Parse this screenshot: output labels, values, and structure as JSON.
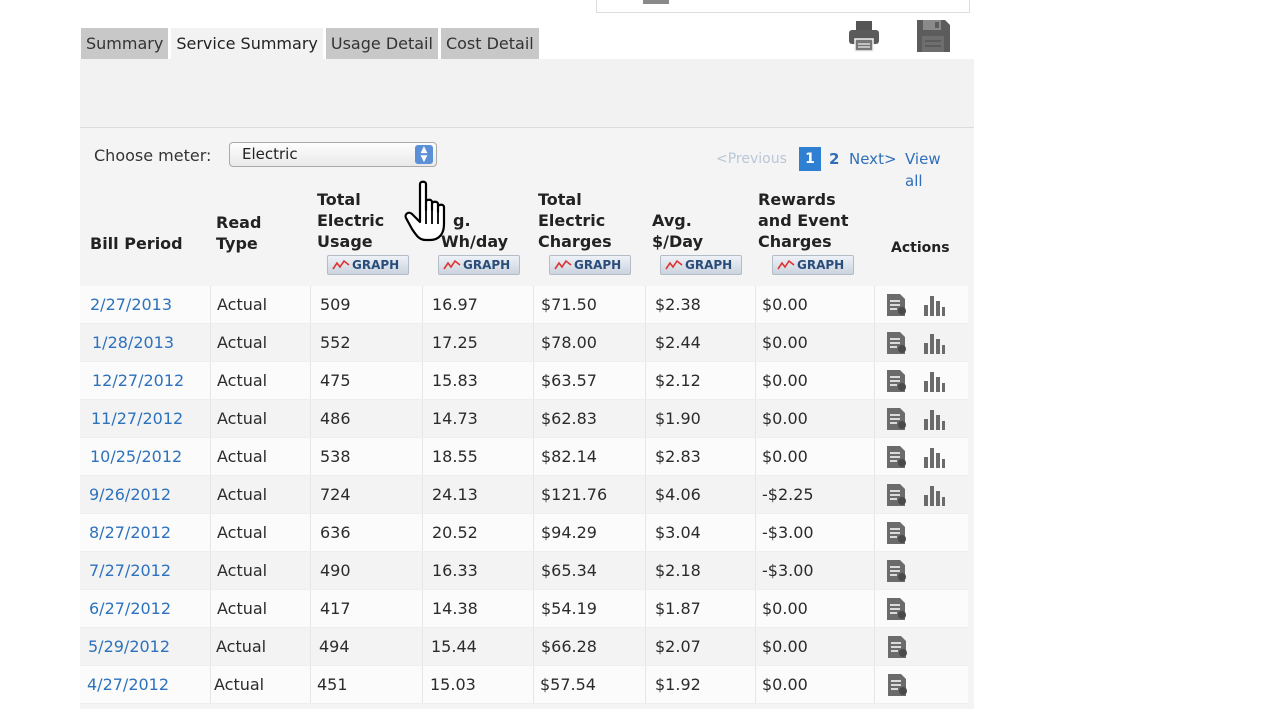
{
  "tabs": [
    {
      "label": "Summary",
      "active": false
    },
    {
      "label": "Service Summary",
      "active": true
    },
    {
      "label": "Usage Detail",
      "active": false
    },
    {
      "label": "Cost Detail",
      "active": false
    }
  ],
  "toolbar": {
    "print_icon": "printer-icon",
    "save_icon": "floppy-disk-icon"
  },
  "meter": {
    "label": "Choose meter:",
    "selected": "Electric"
  },
  "pagination": {
    "previous": "<Previous",
    "current": "1",
    "page2": "2",
    "next": "Next>",
    "view_all": "View all"
  },
  "columns": {
    "bill_period": "Bill Period",
    "read_type_1": "Read",
    "read_type_2": "Type",
    "usage_1": "Total",
    "usage_2": "Electric",
    "usage_3": "Usage",
    "avg_kwh_1": "g.",
    "avg_kwh_2": "Wh/day",
    "charges_1": "Total",
    "charges_2": "Electric",
    "charges_3": "Charges",
    "avg_day_1": "Avg.",
    "avg_day_2": "$/Day",
    "rewards_1": "Rewards",
    "rewards_2": "and Event",
    "rewards_3": "Charges",
    "actions": "Actions",
    "graph_label": "GRAPH"
  },
  "rows": [
    {
      "period": "2/27/2013",
      "type": "Actual",
      "usage": "509",
      "kwh_day": "16.97",
      "charges": "$71.50",
      "per_day": "$2.38",
      "rewards": "$0.00",
      "graph": true
    },
    {
      "period": "1/28/2013",
      "type": "Actual",
      "usage": "552",
      "kwh_day": "17.25",
      "charges": "$78.00",
      "per_day": "$2.44",
      "rewards": "$0.00",
      "graph": true
    },
    {
      "period": "12/27/2012",
      "type": "Actual",
      "usage": "475",
      "kwh_day": "15.83",
      "charges": "$63.57",
      "per_day": "$2.12",
      "rewards": "$0.00",
      "graph": true
    },
    {
      "period": "11/27/2012",
      "type": "Actual",
      "usage": "486",
      "kwh_day": "14.73",
      "charges": "$62.83",
      "per_day": "$1.90",
      "rewards": "$0.00",
      "graph": true
    },
    {
      "period": "10/25/2012",
      "type": "Actual",
      "usage": "538",
      "kwh_day": "18.55",
      "charges": "$82.14",
      "per_day": "$2.83",
      "rewards": "$0.00",
      "graph": true
    },
    {
      "period": "9/26/2012",
      "type": "Actual",
      "usage": "724",
      "kwh_day": "24.13",
      "charges": "$121.76",
      "per_day": "$4.06",
      "rewards": "-$2.25",
      "graph": true
    },
    {
      "period": "8/27/2012",
      "type": "Actual",
      "usage": "636",
      "kwh_day": "20.52",
      "charges": "$94.29",
      "per_day": "$3.04",
      "rewards": "-$3.00",
      "graph": false
    },
    {
      "period": "7/27/2012",
      "type": "Actual",
      "usage": "490",
      "kwh_day": "16.33",
      "charges": "$65.34",
      "per_day": "$2.18",
      "rewards": "-$3.00",
      "graph": false
    },
    {
      "period": "6/27/2012",
      "type": "Actual",
      "usage": "417",
      "kwh_day": "14.38",
      "charges": "$54.19",
      "per_day": "$1.87",
      "rewards": "$0.00",
      "graph": false
    },
    {
      "period": "5/29/2012",
      "type": "Actual",
      "usage": "494",
      "kwh_day": "15.44",
      "charges": "$66.28",
      "per_day": "$2.07",
      "rewards": "$0.00",
      "graph": false
    },
    {
      "period": "4/27/2012",
      "type": "Actual",
      "usage": "451",
      "kwh_day": "15.03",
      "charges": "$57.54",
      "per_day": "$1.92",
      "rewards": "$0.00",
      "graph": false
    }
  ],
  "colors": {
    "link": "#2d72bd",
    "pager_active": "#2f7fd2",
    "tab_inactive": "#c8c8c8"
  }
}
